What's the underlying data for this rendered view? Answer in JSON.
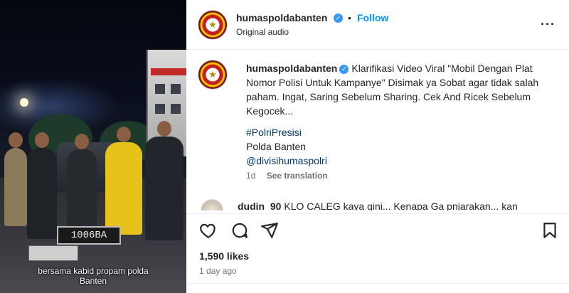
{
  "video": {
    "plate_text": "1006BA",
    "subtitle_line1": "bersama kabid propam polda",
    "subtitle_line2": "Banten"
  },
  "header": {
    "username": "humaspoldabanten",
    "separator": "•",
    "follow_label": "Follow",
    "audio_label": "Original audio",
    "more_icon": "more-horizontal-icon"
  },
  "caption": {
    "username": "humaspoldabanten",
    "text": "Klarifikasi Video Viral \"Mobil Dengan Plat Nomor Polisi Untuk Kampanye\" Disimak ya Sobat agar tidak salah paham. Ingat, Saring Sebelum Sharing. Cek And Ricek Sebelum Kegocek...",
    "hashtag": "#PolriPresisi",
    "line2": "Polda Banten",
    "mention": "@divisihumaspolri",
    "age": "1d",
    "see_translation": "See translation"
  },
  "comment": {
    "username": "dudin_90",
    "text": "KLO CALEG kaya gini... Kenapa Ga pnjarakan... kan"
  },
  "actions": {
    "like_icon": "heart-icon",
    "comment_icon": "comment-icon",
    "share_icon": "share-icon",
    "save_icon": "bookmark-icon"
  },
  "stats": {
    "likes": "1,590 likes",
    "time": "1 day ago"
  },
  "colors": {
    "link_blue": "#0095f6",
    "verified_blue": "#3897f0",
    "tag_blue": "#00376b",
    "muted": "#737373"
  }
}
